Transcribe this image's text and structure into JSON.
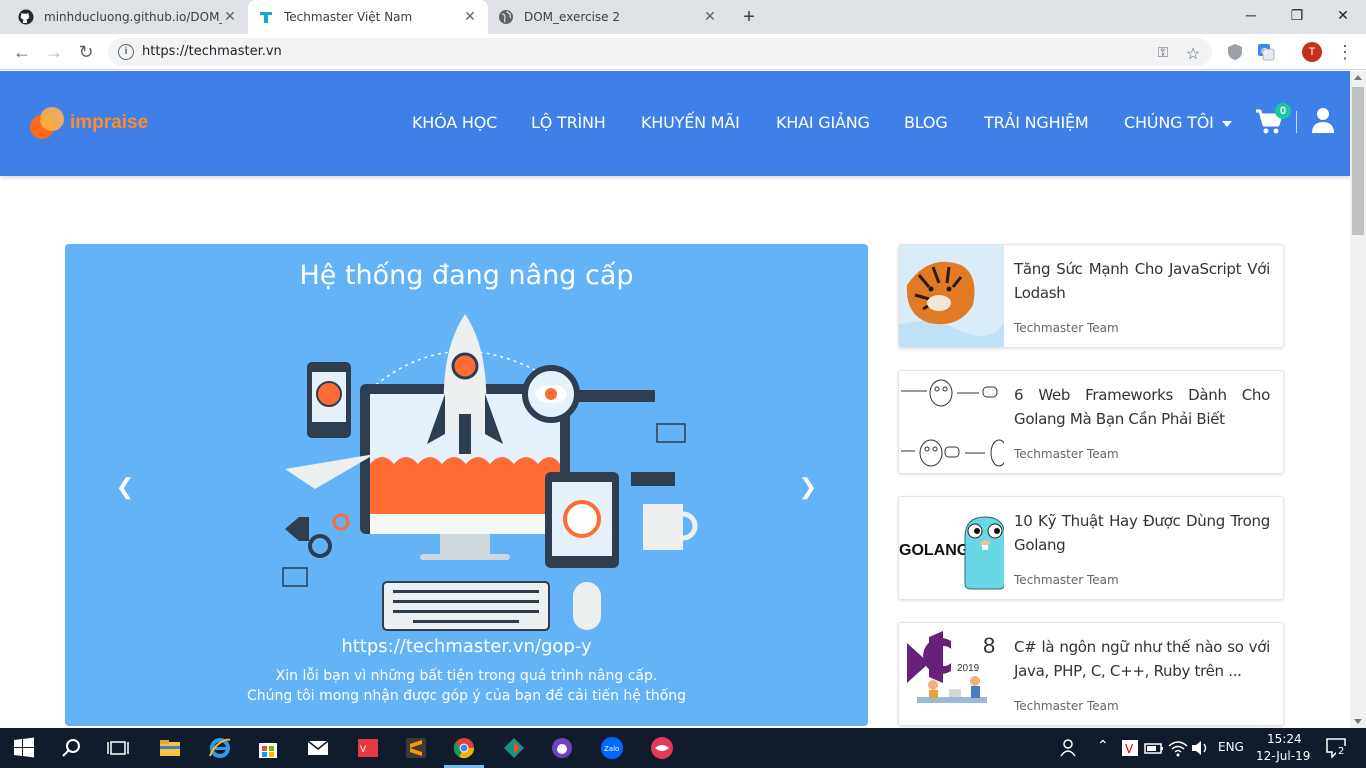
{
  "browser": {
    "tabs": [
      {
        "title": "minhducluong.github.io/DOM_ex",
        "icon": "github-icon"
      },
      {
        "title": "Techmaster Việt Nam",
        "icon": "techmaster-icon"
      },
      {
        "title": "DOM_exercise 2",
        "icon": "globe-icon"
      }
    ],
    "url": "https://techmaster.vn",
    "profile_initial": "T"
  },
  "site": {
    "logo_text": "impraise",
    "nav": [
      "KHÓA HỌC",
      "LỘ TRÌNH",
      "KHUYẾN MÃI",
      "KHAI GIẢNG",
      "BLOG",
      "TRẢI NGHIỆM",
      "CHÚNG TÔI"
    ],
    "cart_count": "0"
  },
  "banner": {
    "title": "Hệ thống đang nâng cấp",
    "url": "https://techmaster.vn/gop-y",
    "line1": "Xin lỗi bạn vì những bất tiện trong quá trình nâng cấp.",
    "line2": "Chúng tôi mong nhận được góp ý của bạn để cải tiến hệ thống"
  },
  "articles": [
    {
      "title": "Tăng Sức Mạnh Cho JavaScript Với Lodash",
      "author": "Techmaster Team",
      "thumb": "tiger-image"
    },
    {
      "title": "6 Web Frameworks Dành Cho Golang Mà Bạn Cần Phải Biết",
      "author": "Techmaster Team",
      "thumb": "gopher-sketch-image"
    },
    {
      "title": "10 Kỹ Thuật Hay Được Dùng Trong Golang",
      "author": "Techmaster Team",
      "thumb": "golang-gopher-image",
      "thumb_text": "GOLANG"
    },
    {
      "title": "C# là ngôn ngữ như thế nào so với Java, PHP, C, C++, Ruby trên ...",
      "author": "Techmaster Team",
      "thumb": "csharp-2019-image",
      "thumb_text": "2019"
    }
  ],
  "taskbar": {
    "lang": "ENG",
    "time": "15:24",
    "date": "12-Jul-19",
    "notifications": "2"
  },
  "colors": {
    "header": "#3f7fe8",
    "banner": "#63b3f6",
    "accent_orange": "#ff8a2a",
    "badge": "#1cc7a0"
  }
}
